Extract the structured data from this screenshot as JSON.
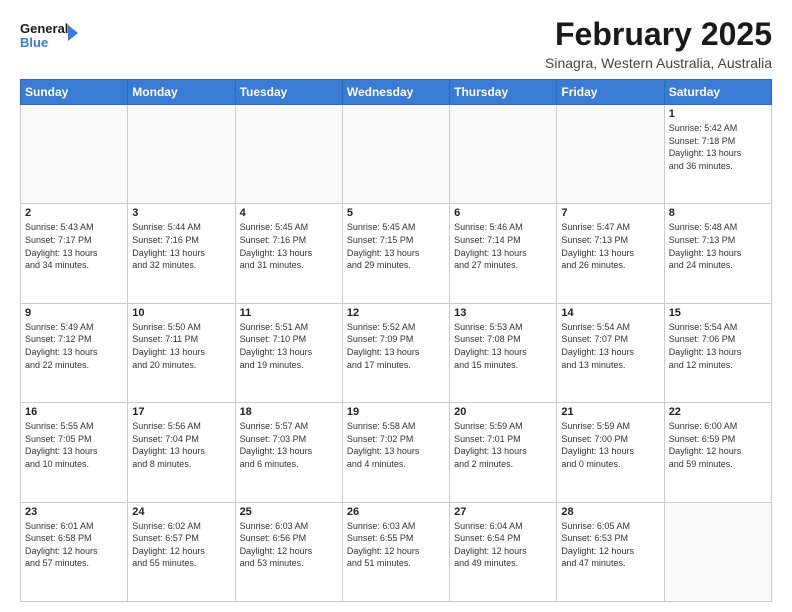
{
  "logo": {
    "line1": "General",
    "line2": "Blue"
  },
  "title": "February 2025",
  "subtitle": "Sinagra, Western Australia, Australia",
  "weekdays": [
    "Sunday",
    "Monday",
    "Tuesday",
    "Wednesday",
    "Thursday",
    "Friday",
    "Saturday"
  ],
  "weeks": [
    [
      {
        "day": "",
        "info": ""
      },
      {
        "day": "",
        "info": ""
      },
      {
        "day": "",
        "info": ""
      },
      {
        "day": "",
        "info": ""
      },
      {
        "day": "",
        "info": ""
      },
      {
        "day": "",
        "info": ""
      },
      {
        "day": "1",
        "info": "Sunrise: 5:42 AM\nSunset: 7:18 PM\nDaylight: 13 hours\nand 36 minutes."
      }
    ],
    [
      {
        "day": "2",
        "info": "Sunrise: 5:43 AM\nSunset: 7:17 PM\nDaylight: 13 hours\nand 34 minutes."
      },
      {
        "day": "3",
        "info": "Sunrise: 5:44 AM\nSunset: 7:16 PM\nDaylight: 13 hours\nand 32 minutes."
      },
      {
        "day": "4",
        "info": "Sunrise: 5:45 AM\nSunset: 7:16 PM\nDaylight: 13 hours\nand 31 minutes."
      },
      {
        "day": "5",
        "info": "Sunrise: 5:45 AM\nSunset: 7:15 PM\nDaylight: 13 hours\nand 29 minutes."
      },
      {
        "day": "6",
        "info": "Sunrise: 5:46 AM\nSunset: 7:14 PM\nDaylight: 13 hours\nand 27 minutes."
      },
      {
        "day": "7",
        "info": "Sunrise: 5:47 AM\nSunset: 7:13 PM\nDaylight: 13 hours\nand 26 minutes."
      },
      {
        "day": "8",
        "info": "Sunrise: 5:48 AM\nSunset: 7:13 PM\nDaylight: 13 hours\nand 24 minutes."
      }
    ],
    [
      {
        "day": "9",
        "info": "Sunrise: 5:49 AM\nSunset: 7:12 PM\nDaylight: 13 hours\nand 22 minutes."
      },
      {
        "day": "10",
        "info": "Sunrise: 5:50 AM\nSunset: 7:11 PM\nDaylight: 13 hours\nand 20 minutes."
      },
      {
        "day": "11",
        "info": "Sunrise: 5:51 AM\nSunset: 7:10 PM\nDaylight: 13 hours\nand 19 minutes."
      },
      {
        "day": "12",
        "info": "Sunrise: 5:52 AM\nSunset: 7:09 PM\nDaylight: 13 hours\nand 17 minutes."
      },
      {
        "day": "13",
        "info": "Sunrise: 5:53 AM\nSunset: 7:08 PM\nDaylight: 13 hours\nand 15 minutes."
      },
      {
        "day": "14",
        "info": "Sunrise: 5:54 AM\nSunset: 7:07 PM\nDaylight: 13 hours\nand 13 minutes."
      },
      {
        "day": "15",
        "info": "Sunrise: 5:54 AM\nSunset: 7:06 PM\nDaylight: 13 hours\nand 12 minutes."
      }
    ],
    [
      {
        "day": "16",
        "info": "Sunrise: 5:55 AM\nSunset: 7:05 PM\nDaylight: 13 hours\nand 10 minutes."
      },
      {
        "day": "17",
        "info": "Sunrise: 5:56 AM\nSunset: 7:04 PM\nDaylight: 13 hours\nand 8 minutes."
      },
      {
        "day": "18",
        "info": "Sunrise: 5:57 AM\nSunset: 7:03 PM\nDaylight: 13 hours\nand 6 minutes."
      },
      {
        "day": "19",
        "info": "Sunrise: 5:58 AM\nSunset: 7:02 PM\nDaylight: 13 hours\nand 4 minutes."
      },
      {
        "day": "20",
        "info": "Sunrise: 5:59 AM\nSunset: 7:01 PM\nDaylight: 13 hours\nand 2 minutes."
      },
      {
        "day": "21",
        "info": "Sunrise: 5:59 AM\nSunset: 7:00 PM\nDaylight: 13 hours\nand 0 minutes."
      },
      {
        "day": "22",
        "info": "Sunrise: 6:00 AM\nSunset: 6:59 PM\nDaylight: 12 hours\nand 59 minutes."
      }
    ],
    [
      {
        "day": "23",
        "info": "Sunrise: 6:01 AM\nSunset: 6:58 PM\nDaylight: 12 hours\nand 57 minutes."
      },
      {
        "day": "24",
        "info": "Sunrise: 6:02 AM\nSunset: 6:57 PM\nDaylight: 12 hours\nand 55 minutes."
      },
      {
        "day": "25",
        "info": "Sunrise: 6:03 AM\nSunset: 6:56 PM\nDaylight: 12 hours\nand 53 minutes."
      },
      {
        "day": "26",
        "info": "Sunrise: 6:03 AM\nSunset: 6:55 PM\nDaylight: 12 hours\nand 51 minutes."
      },
      {
        "day": "27",
        "info": "Sunrise: 6:04 AM\nSunset: 6:54 PM\nDaylight: 12 hours\nand 49 minutes."
      },
      {
        "day": "28",
        "info": "Sunrise: 6:05 AM\nSunset: 6:53 PM\nDaylight: 12 hours\nand 47 minutes."
      },
      {
        "day": "",
        "info": ""
      }
    ]
  ]
}
